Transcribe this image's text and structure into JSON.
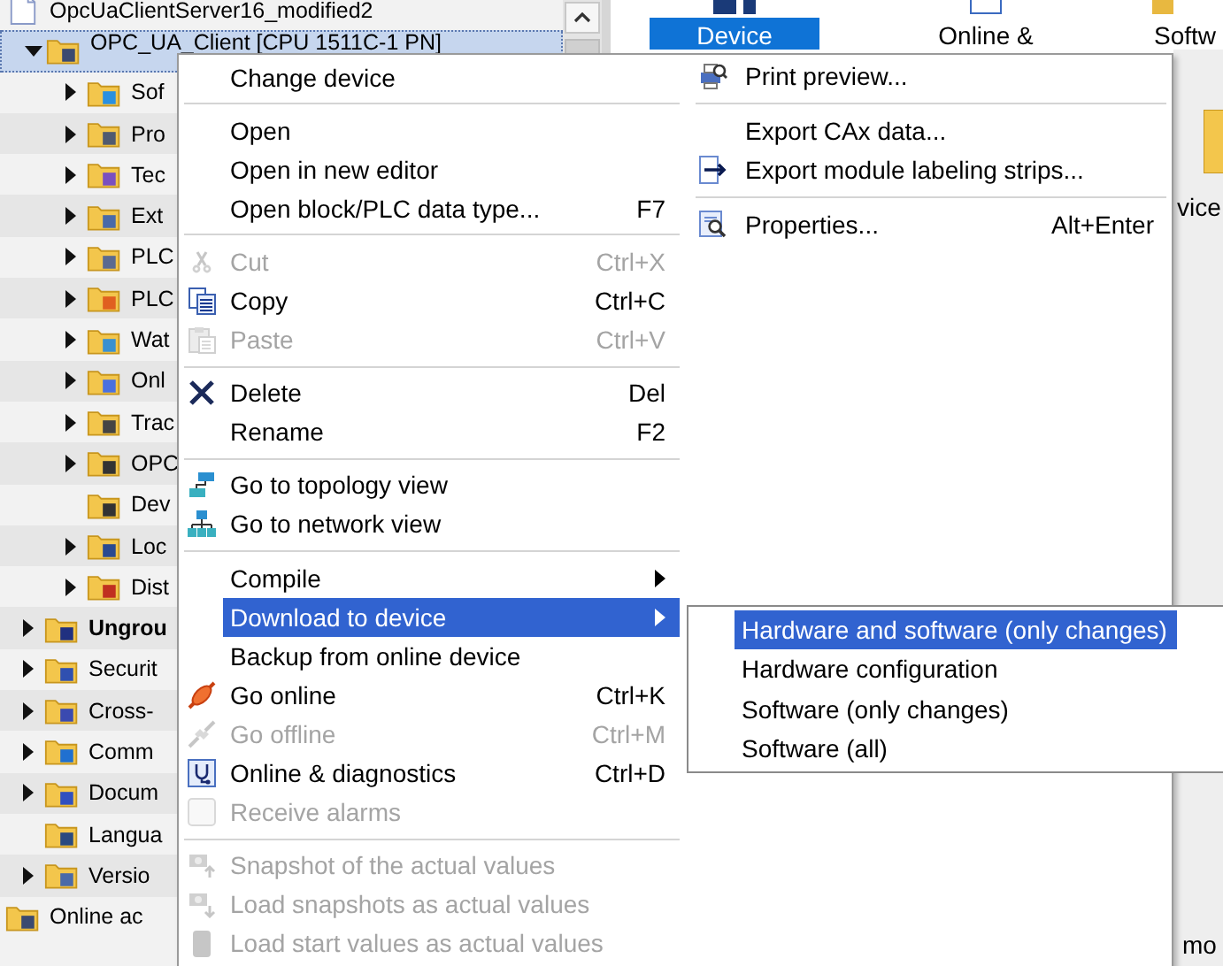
{
  "tree": {
    "items": [
      {
        "label": "OpcUaClientServer16_modified2",
        "selected": false,
        "children": [
          {
            "label": "OPC_UA_Client [CPU 1511C-1 PN]",
            "selected": true,
            "expanded": true,
            "children": [
              {
                "label": "Sof",
                "selected": false,
                "expanded": false
              },
              {
                "label": "Pro",
                "selected": false,
                "expanded": false
              },
              {
                "label": "Tec",
                "selected": false,
                "expanded": false
              },
              {
                "label": "Ext",
                "selected": false,
                "expanded": false
              },
              {
                "label": "PLC",
                "selected": false,
                "expanded": false
              },
              {
                "label": "PLC",
                "selected": false,
                "expanded": false
              },
              {
                "label": "Wat",
                "selected": false,
                "expanded": false
              },
              {
                "label": "Onl",
                "selected": false,
                "expanded": false
              },
              {
                "label": "Trac",
                "selected": false,
                "expanded": false
              },
              {
                "label": "OPC",
                "selected": false,
                "expanded": false
              },
              {
                "label": "Dev",
                "selected": false,
                "leaf": true
              },
              {
                "label": "Loc",
                "selected": false,
                "expanded": false
              },
              {
                "label": "Dist",
                "selected": false,
                "expanded": false
              }
            ]
          },
          {
            "label": "Ungrou",
            "selected": false,
            "expanded": false,
            "emphasized": true
          },
          {
            "label": "Securit",
            "selected": false,
            "expanded": false
          },
          {
            "label": "Cross-",
            "selected": false,
            "expanded": false
          },
          {
            "label": "Comm",
            "selected": false,
            "expanded": false
          },
          {
            "label": "Docum",
            "selected": false,
            "expanded": false
          },
          {
            "label": "Langua",
            "selected": false,
            "leaf": true
          },
          {
            "label": "Versio",
            "selected": false,
            "expanded": false
          }
        ]
      },
      {
        "label": "Online ac",
        "selected": false,
        "leaf": true
      }
    ]
  },
  "toolbar": {
    "buttons": [
      {
        "label": "Device",
        "selected": true
      },
      {
        "label": "Online &",
        "selected": false
      },
      {
        "label": "Softw",
        "selected": false
      }
    ]
  },
  "right_pane": {
    "text_1": "vice",
    "text_2": "mo"
  },
  "context_menu": {
    "main_items": [
      {
        "kind": "item",
        "label": "Change device",
        "disabled": false,
        "selected": false
      },
      {
        "kind": "separator"
      },
      {
        "kind": "item",
        "label": "Open",
        "disabled": false,
        "selected": false
      },
      {
        "kind": "item",
        "label": "Open in new editor",
        "disabled": false,
        "selected": false
      },
      {
        "kind": "item",
        "label": "Open block/PLC data type...",
        "shortcut": "F7",
        "disabled": false,
        "selected": false
      },
      {
        "kind": "separator"
      },
      {
        "kind": "item",
        "label": "Cut",
        "shortcut": "Ctrl+X",
        "disabled": true,
        "selected": false
      },
      {
        "kind": "item",
        "label": "Copy",
        "shortcut": "Ctrl+C",
        "disabled": false,
        "selected": false
      },
      {
        "kind": "item",
        "label": "Paste",
        "shortcut": "Ctrl+V",
        "disabled": true,
        "selected": false
      },
      {
        "kind": "separator"
      },
      {
        "kind": "item",
        "label": "Delete",
        "shortcut": "Del",
        "disabled": false,
        "selected": false
      },
      {
        "kind": "item",
        "label": "Rename",
        "shortcut": "F2",
        "disabled": false,
        "selected": false
      },
      {
        "kind": "separator"
      },
      {
        "kind": "item",
        "label": "Go to topology view",
        "disabled": false,
        "selected": false
      },
      {
        "kind": "item",
        "label": "Go to network view",
        "disabled": false,
        "selected": false
      },
      {
        "kind": "separator"
      },
      {
        "kind": "item",
        "label": "Compile",
        "disabled": false,
        "selected": false,
        "has_submenu": true
      },
      {
        "kind": "item",
        "label": "Download to device",
        "disabled": false,
        "selected": true,
        "has_submenu": true
      },
      {
        "kind": "item",
        "label": "Backup from online device",
        "disabled": false,
        "selected": false
      },
      {
        "kind": "item",
        "label": "Go online",
        "shortcut": "Ctrl+K",
        "disabled": false,
        "selected": false
      },
      {
        "kind": "item",
        "label": "Go offline",
        "shortcut": "Ctrl+M",
        "disabled": true,
        "selected": false
      },
      {
        "kind": "item",
        "label": "Online & diagnostics",
        "shortcut": "Ctrl+D",
        "disabled": false,
        "selected": false
      },
      {
        "kind": "check",
        "label": "Receive alarms",
        "checked": false,
        "disabled": true,
        "selected": false
      },
      {
        "kind": "separator"
      },
      {
        "kind": "item",
        "label": "Snapshot of the actual values",
        "disabled": true,
        "selected": false
      },
      {
        "kind": "item",
        "label": "Load snapshots as actual values",
        "disabled": true,
        "selected": false
      },
      {
        "kind": "item",
        "label": "Load start values as actual values",
        "disabled": true,
        "selected": false
      }
    ],
    "side_items": [
      {
        "kind": "item",
        "label": "Print preview...",
        "disabled": false,
        "selected": false
      },
      {
        "kind": "separator"
      },
      {
        "kind": "item",
        "label": "Export CAx data...",
        "disabled": false,
        "selected": false
      },
      {
        "kind": "item",
        "label": "Export module labeling strips...",
        "disabled": false,
        "selected": false
      },
      {
        "kind": "separator"
      },
      {
        "kind": "item",
        "label": "Properties...",
        "shortcut": "Alt+Enter",
        "disabled": false,
        "selected": false
      }
    ]
  },
  "download_submenu": {
    "items": [
      {
        "kind": "item",
        "label": "Hardware and software (only changes)",
        "disabled": false,
        "selected": true
      },
      {
        "kind": "item",
        "label": "Hardware configuration",
        "disabled": false,
        "selected": false
      },
      {
        "kind": "item",
        "label": "Software (only changes)",
        "disabled": false,
        "selected": false
      },
      {
        "kind": "item",
        "label": "Software (all)",
        "disabled": false,
        "selected": false
      }
    ]
  }
}
